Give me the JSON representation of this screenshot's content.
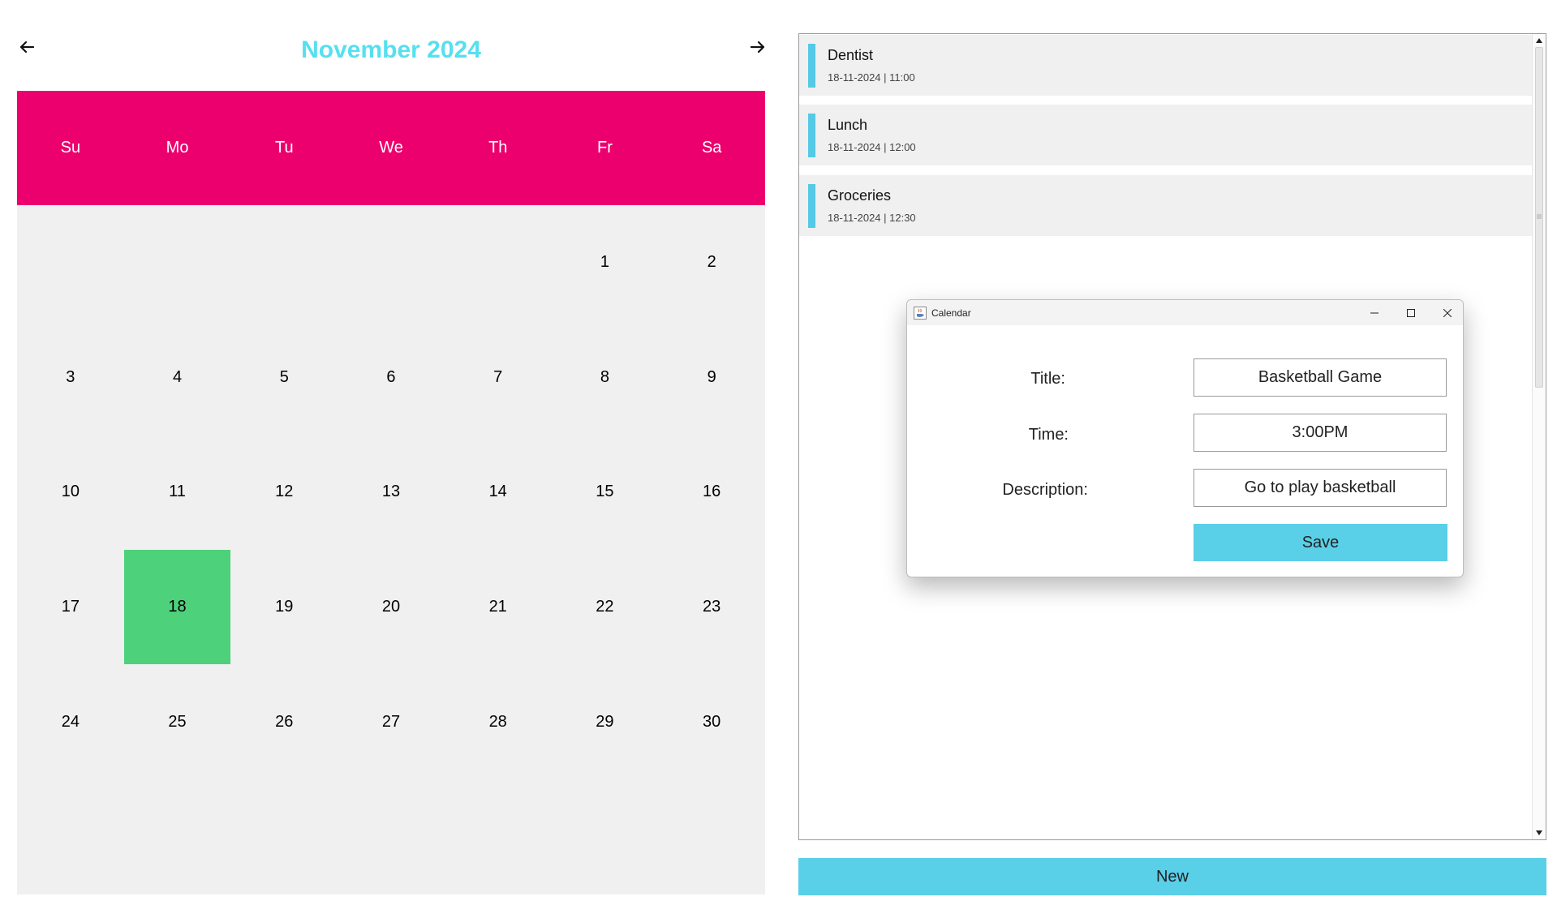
{
  "calendar": {
    "month_title": "November 2024",
    "weekdays": [
      "Su",
      "Mo",
      "Tu",
      "We",
      "Th",
      "Fr",
      "Sa"
    ],
    "first_weekday_index": 5,
    "days_in_month": 30,
    "selected_day": 18,
    "colors": {
      "title": "#55e0f0",
      "header_bg": "#ec006e",
      "grid_bg": "#f0f0f0",
      "selected_bg": "#4dd17a"
    }
  },
  "events": [
    {
      "title": "Dentist",
      "meta": "18-11-2024 | 11:00"
    },
    {
      "title": "Lunch",
      "meta": "18-11-2024 | 12:00"
    },
    {
      "title": "Groceries",
      "meta": "18-11-2024 | 12:30"
    }
  ],
  "event_accent": "#55c9e6",
  "new_button": {
    "label": "New"
  },
  "dialog": {
    "window_title": "Calendar",
    "fields": {
      "title_label": "Title:",
      "title_value": "Basketball Game",
      "time_label": "Time:",
      "time_value": "3:00PM",
      "description_label": "Description:",
      "description_value": "Go to play basketball"
    },
    "save_label": "Save",
    "icons": {
      "app": "java-cup-icon",
      "minimize": "minimize-icon",
      "maximize": "maximize-icon",
      "close": "close-icon"
    }
  }
}
